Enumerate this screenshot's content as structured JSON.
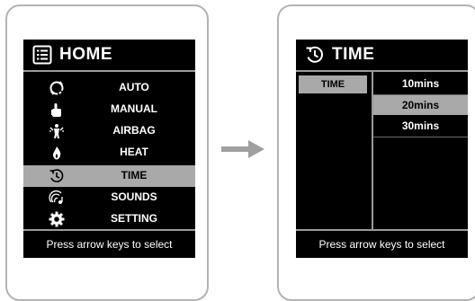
{
  "home_screen": {
    "title": "HOME",
    "title_icon": "list-icon",
    "items": [
      {
        "label": "AUTO",
        "icon": "cycle-icon",
        "selected": false
      },
      {
        "label": "MANUAL",
        "icon": "hand-icon",
        "selected": false
      },
      {
        "label": "AIRBAG",
        "icon": "body-icon",
        "selected": false
      },
      {
        "label": "HEAT",
        "icon": "flame-icon",
        "selected": false
      },
      {
        "label": "TIME",
        "icon": "clock-icon",
        "selected": true
      },
      {
        "label": "SOUNDS",
        "icon": "sound-icon",
        "selected": false
      },
      {
        "label": "SETTING",
        "icon": "gear-icon",
        "selected": false
      }
    ],
    "footer": "Press arrow keys to select"
  },
  "time_screen": {
    "title": "TIME",
    "title_icon": "clock-icon",
    "left_item": "TIME",
    "options": [
      {
        "label": "10mins",
        "selected": false
      },
      {
        "label": "20mins",
        "selected": true
      },
      {
        "label": "30mins",
        "selected": false
      }
    ],
    "footer": "Press arrow keys to select"
  },
  "colors": {
    "screen_bg": "#000000",
    "highlight": "#a9a9a9",
    "border": "#b3b3b3",
    "arrow": "#a0a0a0"
  }
}
